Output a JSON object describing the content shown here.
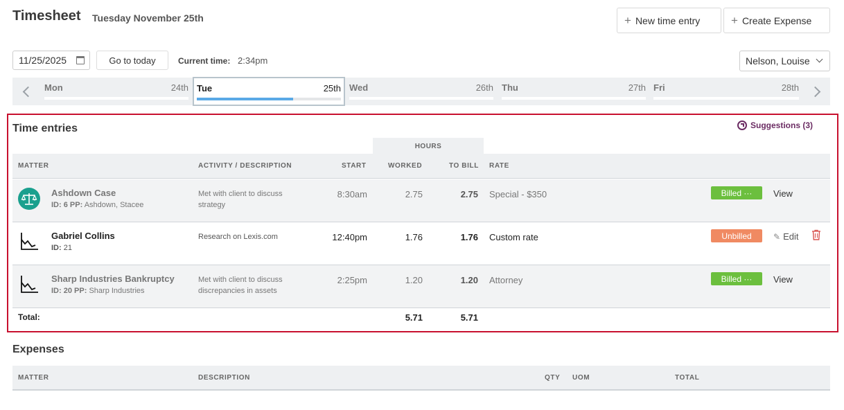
{
  "header": {
    "title": "Timesheet",
    "date": "Tuesday November 25th",
    "new_entry_label": "New time entry",
    "create_expense_label": "Create Expense"
  },
  "toolbar": {
    "date_value": "11/25/2025",
    "go_today_label": "Go to today",
    "current_time_label": "Current time:",
    "current_time_value": "2:34pm",
    "user_selected": "Nelson, Louise"
  },
  "week": {
    "days": [
      {
        "name": "Mon",
        "num": "24th",
        "progress": 0,
        "active": false
      },
      {
        "name": "Tue",
        "num": "25th",
        "progress": 0.67,
        "active": true
      },
      {
        "name": "Wed",
        "num": "26th",
        "progress": 0,
        "active": false
      },
      {
        "name": "Thu",
        "num": "27th",
        "progress": 0,
        "active": false
      },
      {
        "name": "Fri",
        "num": "28th",
        "progress": 0,
        "active": false
      }
    ]
  },
  "time_entries": {
    "title": "Time entries",
    "suggestions_label": "Suggestions (3)",
    "hours_group_label": "HOURS",
    "columns": {
      "matter": "MATTER",
      "activity": "ACTIVITY / DESCRIPTION",
      "start": "START",
      "worked": "WORKED",
      "to_bill": "TO BILL",
      "rate": "RATE"
    },
    "rows": [
      {
        "name": "Ashdown Case",
        "id_label": "ID:",
        "id": "6",
        "pp_label": "PP:",
        "pp": "Ashdown, Stacee",
        "icon": "scales-icon",
        "activity": "Met with client to discuss strategy",
        "start": "8:30am",
        "worked": "2.75",
        "to_bill": "2.75",
        "rate": "Special - $350",
        "status": "Billed ···",
        "action": "View"
      },
      {
        "name": "Gabriel Collins",
        "id_label": "ID:",
        "id": "21",
        "icon": "chart-decline-icon",
        "activity": "Research on Lexis.com",
        "start": "12:40pm",
        "worked": "1.76",
        "to_bill": "1.76",
        "rate": "Custom rate",
        "status": "Unbilled",
        "action": "Edit"
      },
      {
        "name": "Sharp Industries Bankruptcy",
        "id_label": "ID:",
        "id": "20",
        "pp_label": "PP:",
        "pp": "Sharp Industries",
        "icon": "chart-decline-icon",
        "activity": "Met with client to discuss discrepancies in assets",
        "start": "2:25pm",
        "worked": "1.20",
        "to_bill": "1.20",
        "rate": "Attorney",
        "status": "Billed ···",
        "action": "View"
      }
    ],
    "total_label": "Total:",
    "total_worked": "5.71",
    "total_to_bill": "5.71"
  },
  "expenses": {
    "title": "Expenses",
    "columns": {
      "matter": "MATTER",
      "description": "DESCRIPTION",
      "qty": "QTY",
      "uom": "UOM",
      "total": "TOTAL"
    }
  },
  "colors": {
    "accent_red": "#c8102e",
    "billed_green": "#6cbf3e",
    "unbilled_orange": "#f08a62",
    "suggestions_purple": "#6b2c63",
    "progress_blue": "#5aa9e6",
    "teal_avatar": "#1aa08e"
  }
}
